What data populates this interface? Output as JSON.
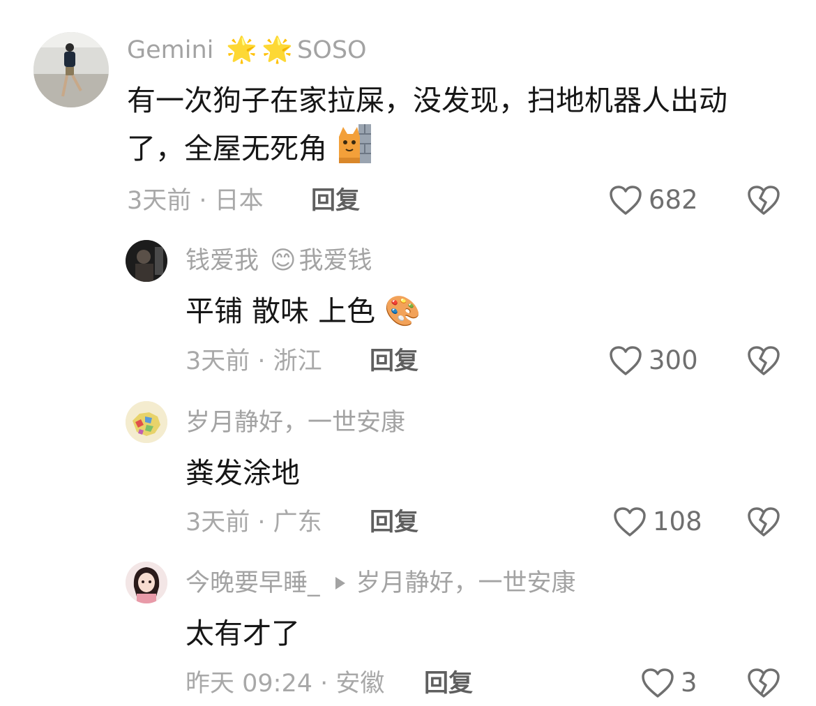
{
  "comments": [
    {
      "user": "Gemini",
      "user_suffix": "SOSO",
      "name_emojis": [
        "🌟",
        "🌟"
      ],
      "text_line1": "有一次狗子在家拉屎，没发现，扫地机器人出动",
      "text_line2": "了，全屋无死角",
      "text_emoji": "cat-peeking-behind-wall-emoji",
      "meta": "3天前 · 日本",
      "reply": "回复",
      "likes": "682"
    },
    {
      "user": "钱爱我",
      "name_emoji": "😊",
      "user_suffix": "我爱钱",
      "text": "平铺 散味 上色",
      "text_emoji": "🎨",
      "meta": "3天前 · 浙江",
      "reply": "回复",
      "likes": "300"
    },
    {
      "user": "岁月静好，一世安康",
      "text": "粪发涂地",
      "meta": "3天前 · 广东",
      "reply": "回复",
      "likes": "108"
    },
    {
      "user": "今晚要早睡_",
      "reply_to": "岁月静好，一世安康",
      "text": "太有才了",
      "meta": "昨天 09:24 · 安徽",
      "reply": "回复",
      "likes": "3"
    }
  ],
  "colors": {
    "name": "#a3a3a3",
    "text": "#161616",
    "meta": "#a8a8a8",
    "reply": "#5f5f5f",
    "icon": "#6f6f6f"
  }
}
